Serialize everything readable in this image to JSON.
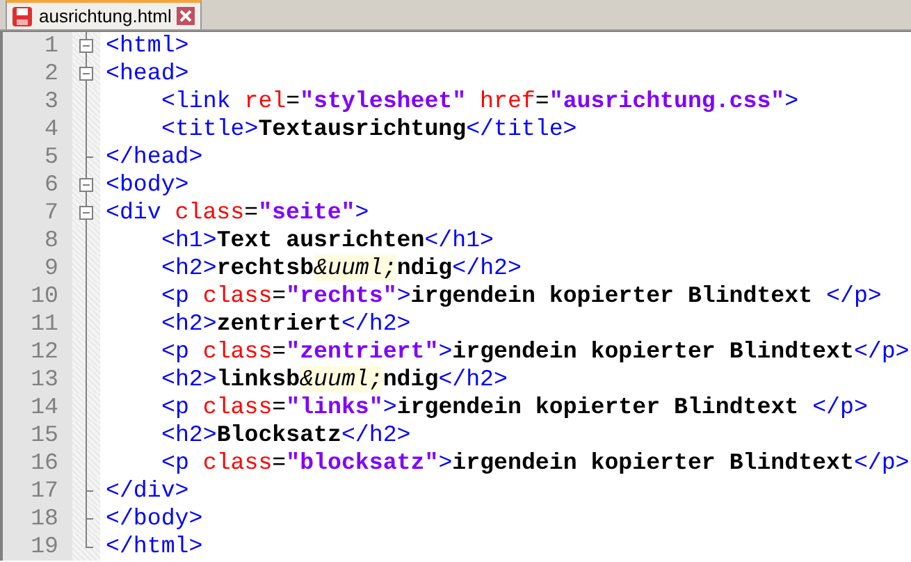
{
  "tab": {
    "title": "ausrichtung.html",
    "selected": true
  },
  "lines": [
    {
      "number": "1",
      "kind": "fold",
      "tokens": [
        {
          "kind": "tag",
          "text": "<html>"
        }
      ]
    },
    {
      "number": "2",
      "kind": "fold",
      "tokens": [
        {
          "kind": "tag",
          "text": "<head>"
        }
      ]
    },
    {
      "number": "3",
      "kind": "inner",
      "tokens": [
        {
          "kind": "tag",
          "text": "<link "
        },
        {
          "kind": "attr",
          "text": "rel"
        },
        {
          "kind": "plain",
          "text": "="
        },
        {
          "kind": "value",
          "text": "\"stylesheet\""
        },
        {
          "kind": "attr",
          "text": " href"
        },
        {
          "kind": "plain",
          "text": "="
        },
        {
          "kind": "value",
          "text": "\"ausrichtung.css\""
        },
        {
          "kind": "tag",
          "text": ">"
        }
      ]
    },
    {
      "number": "4",
      "kind": "inner",
      "tokens": [
        {
          "kind": "tag",
          "text": "<title>"
        },
        {
          "kind": "text",
          "text": "Textausrichtung"
        },
        {
          "kind": "tag",
          "text": "</title>"
        }
      ]
    },
    {
      "number": "5",
      "kind": "end",
      "tokens": [
        {
          "kind": "tag",
          "text": "</head>"
        }
      ]
    },
    {
      "number": "6",
      "kind": "fold",
      "tokens": [
        {
          "kind": "tag",
          "text": "<body>"
        }
      ]
    },
    {
      "number": "7",
      "kind": "fold",
      "tokens": [
        {
          "kind": "tag",
          "text": "<div "
        },
        {
          "kind": "attr",
          "text": "class"
        },
        {
          "kind": "plain",
          "text": "="
        },
        {
          "kind": "value",
          "text": "\"seite\""
        },
        {
          "kind": "tag",
          "text": ">"
        }
      ]
    },
    {
      "number": "8",
      "kind": "inner",
      "tokens": [
        {
          "kind": "tag",
          "text": "<h1>"
        },
        {
          "kind": "text",
          "text": "Text ausrichten"
        },
        {
          "kind": "tag",
          "text": "</h1>"
        }
      ]
    },
    {
      "number": "9",
      "kind": "inner",
      "tokens": [
        {
          "kind": "tag",
          "text": "<h2>"
        },
        {
          "kind": "text",
          "text": "rechtsb"
        },
        {
          "kind": "entity",
          "text": "&uuml;"
        },
        {
          "kind": "text",
          "text": "ndig"
        },
        {
          "kind": "tag",
          "text": "</h2>"
        }
      ]
    },
    {
      "number": "10",
      "kind": "inner",
      "tokens": [
        {
          "kind": "tag",
          "text": "<p "
        },
        {
          "kind": "attr",
          "text": "class"
        },
        {
          "kind": "plain",
          "text": "="
        },
        {
          "kind": "value",
          "text": "\"rechts\""
        },
        {
          "kind": "tag",
          "text": ">"
        },
        {
          "kind": "text",
          "text": "irgendein kopierter Blindtext "
        },
        {
          "kind": "tag",
          "text": "</p>"
        }
      ]
    },
    {
      "number": "11",
      "kind": "inner",
      "tokens": [
        {
          "kind": "tag",
          "text": "<h2>"
        },
        {
          "kind": "text",
          "text": "zentriert"
        },
        {
          "kind": "tag",
          "text": "</h2>"
        }
      ]
    },
    {
      "number": "12",
      "kind": "inner",
      "tokens": [
        {
          "kind": "tag",
          "text": "<p "
        },
        {
          "kind": "attr",
          "text": "class"
        },
        {
          "kind": "plain",
          "text": "="
        },
        {
          "kind": "value",
          "text": "\"zentriert\""
        },
        {
          "kind": "tag",
          "text": ">"
        },
        {
          "kind": "text",
          "text": "irgendein kopierter Blindtext"
        },
        {
          "kind": "tag",
          "text": "</p>"
        }
      ]
    },
    {
      "number": "13",
      "kind": "inner",
      "tokens": [
        {
          "kind": "tag",
          "text": "<h2>"
        },
        {
          "kind": "text",
          "text": "linksb"
        },
        {
          "kind": "entity",
          "text": "&uuml;"
        },
        {
          "kind": "text",
          "text": "ndig"
        },
        {
          "kind": "tag",
          "text": "</h2>"
        }
      ]
    },
    {
      "number": "14",
      "kind": "inner",
      "tokens": [
        {
          "kind": "tag",
          "text": "<p "
        },
        {
          "kind": "attr",
          "text": "class"
        },
        {
          "kind": "plain",
          "text": "="
        },
        {
          "kind": "value",
          "text": "\"links\""
        },
        {
          "kind": "tag",
          "text": ">"
        },
        {
          "kind": "text",
          "text": "irgendein kopierter Blindtext "
        },
        {
          "kind": "tag",
          "text": "</p>"
        }
      ]
    },
    {
      "number": "15",
      "kind": "inner",
      "tokens": [
        {
          "kind": "tag",
          "text": "<h2>"
        },
        {
          "kind": "text",
          "text": "Blocksatz"
        },
        {
          "kind": "tag",
          "text": "</h2>"
        }
      ]
    },
    {
      "number": "16",
      "kind": "inner",
      "tokens": [
        {
          "kind": "tag",
          "text": "<p "
        },
        {
          "kind": "attr",
          "text": "class"
        },
        {
          "kind": "plain",
          "text": "="
        },
        {
          "kind": "value",
          "text": "\"blocksatz\""
        },
        {
          "kind": "tag",
          "text": ">"
        },
        {
          "kind": "text",
          "text": "irgendein kopierter Blindtext"
        },
        {
          "kind": "tag",
          "text": "</p>"
        }
      ]
    },
    {
      "number": "17",
      "kind": "end",
      "tokens": [
        {
          "kind": "tag",
          "text": "</div>"
        }
      ]
    },
    {
      "number": "18",
      "kind": "end",
      "tokens": [
        {
          "kind": "tag",
          "text": "</body>"
        }
      ]
    },
    {
      "number": "19",
      "kind": "last",
      "tokens": [
        {
          "kind": "tag",
          "text": "</html>"
        }
      ]
    }
  ]
}
